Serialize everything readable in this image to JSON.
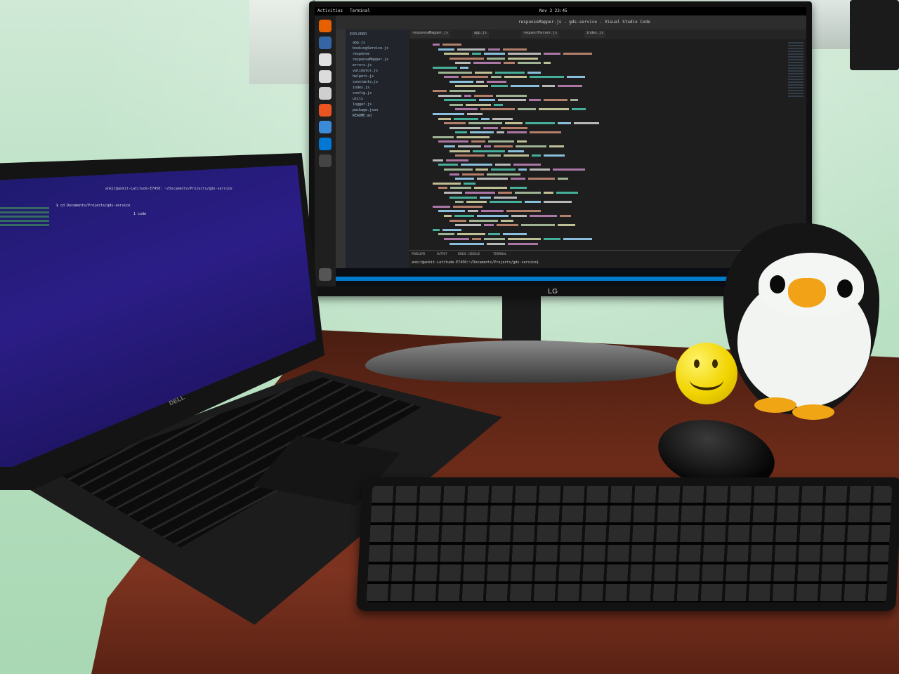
{
  "scene": {
    "description_tags": [
      "monitor",
      "laptop",
      "keyboard",
      "mouse",
      "stress-ball",
      "penguin-plush"
    ]
  },
  "monitor": {
    "brand": "LG",
    "topbar": {
      "activities": "Activities",
      "app": "Terminal",
      "clock": "Nov 3 23:45"
    },
    "vscode": {
      "window_title": "responseMapper.js - gds-service - Visual Studio Code",
      "explorer_label": "EXPLORER",
      "files": [
        "app.js",
        "bookingService.js",
        "response",
        "responseMapper.js",
        "errors.js",
        "validator.js",
        "helpers.js",
        "constants.js",
        "index.js",
        "config.js",
        "utils",
        "logger.js",
        "package.json",
        "README.md"
      ],
      "tabs": [
        "responseMapper.js",
        "app.js",
        "requestParser.js",
        "index.js"
      ],
      "panel_tabs": [
        "PROBLEMS",
        "OUTPUT",
        "DEBUG CONSOLE",
        "TERMINAL"
      ],
      "terminal_line": "ankit@ankit-Latitude-E7450:~/Documents/Projects/gds-service$"
    }
  },
  "laptop": {
    "brand": "DELL",
    "terminal_title": "ankit@ankit-Latitude-E7450: ~/Documents/Projects/gds-service",
    "terminal_cmd": "$ cd Documents/Projects/gds-service",
    "terminal_out": "1 code"
  },
  "colors": {
    "wall": "#b9e0c2",
    "desk": "#6a2a18",
    "smiley": "#f1d400",
    "beak": "#f2a216",
    "vscode_blue": "#007acc"
  }
}
